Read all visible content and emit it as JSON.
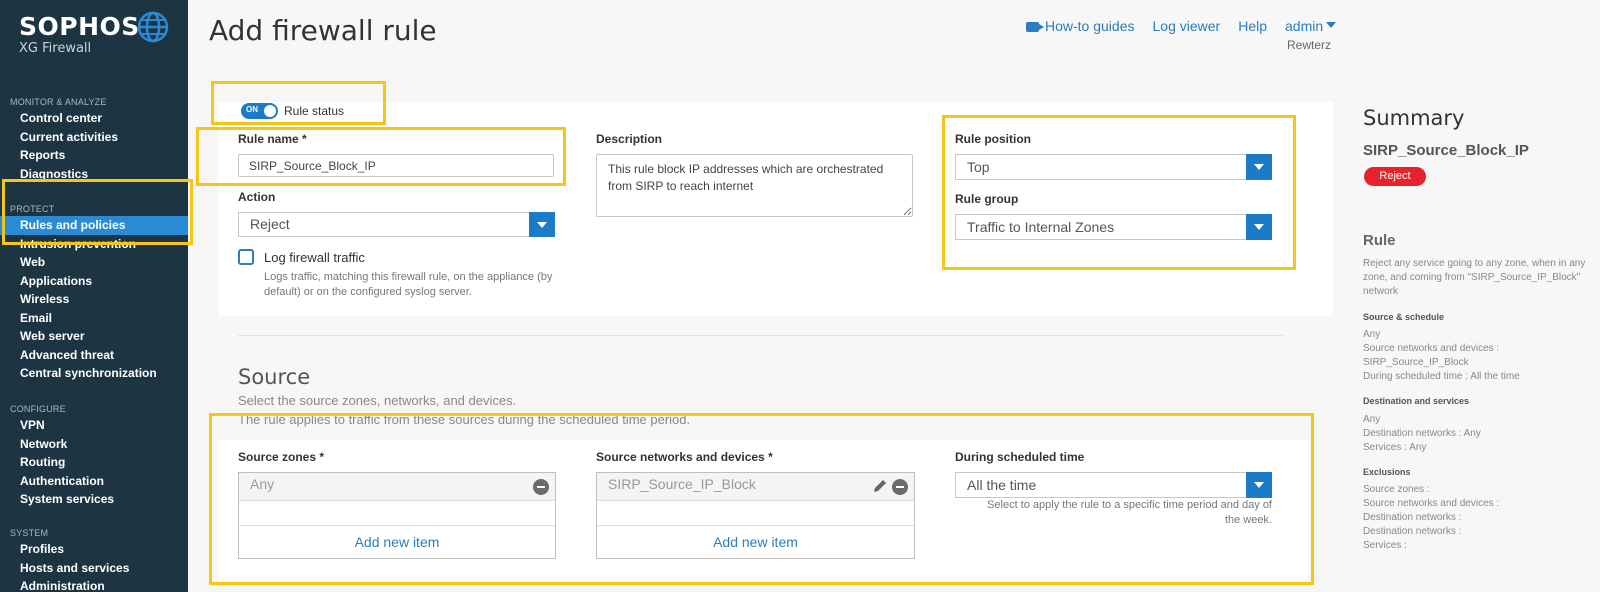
{
  "sidebar": {
    "brand": "SOPHOS",
    "product": "XG Firewall",
    "sections": [
      {
        "heading": "MONITOR & ANALYZE",
        "items": [
          "Control center",
          "Current activities",
          "Reports",
          "Diagnostics"
        ]
      },
      {
        "heading": "PROTECT",
        "items": [
          "Rules and policies",
          "Intrusion prevention",
          "Web",
          "Applications",
          "Wireless",
          "Email",
          "Web server",
          "Advanced threat",
          "Central synchronization"
        ]
      },
      {
        "heading": "CONFIGURE",
        "items": [
          "VPN",
          "Network",
          "Routing",
          "Authentication",
          "System services"
        ]
      },
      {
        "heading": "SYSTEM",
        "items": [
          "Profiles",
          "Hosts and services",
          "Administration"
        ]
      }
    ],
    "active_item": "Rules and policies"
  },
  "header": {
    "title": "Add firewall rule",
    "links": {
      "howto": "How-to guides",
      "log": "Log viewer",
      "help": "Help",
      "user": "admin"
    },
    "user_sub": "Rewterz"
  },
  "form": {
    "status_label": "Rule status",
    "status_toggle": "ON",
    "rule_name_label": "Rule name *",
    "rule_name_value": "SIRP_Source_Block_IP",
    "description_label": "Description",
    "description_value": "This rule block IP addresses which are orchestrated from SIRP to reach internet",
    "action_label": "Action",
    "action_value": "Reject",
    "log_label": "Log firewall traffic",
    "log_help": "Logs traffic, matching this firewall rule, on the appliance (by default) or on the configured syslog server.",
    "rule_position_label": "Rule position",
    "rule_position_value": "Top",
    "rule_group_label": "Rule group",
    "rule_group_value": "Traffic to Internal Zones"
  },
  "source": {
    "title": "Source",
    "desc1": "Select the source zones, networks, and devices.",
    "desc2": "The rule applies to traffic from these sources during the scheduled time period.",
    "zones_label": "Source zones *",
    "zones_value": "Any",
    "zones_add": "Add new item",
    "networks_label": "Source networks and devices *",
    "networks_value": "SIRP_Source_IP_Block",
    "networks_add": "Add new item",
    "schedule_label": "During scheduled time",
    "schedule_value": "All the time",
    "schedule_help": "Select to apply the rule to a specific time period and day of the week."
  },
  "summary": {
    "title": "Summary",
    "rule_name": "SIRP_Source_Block_IP",
    "action_badge": "Reject",
    "rule_heading": "Rule",
    "rule_text": "Reject any service going to any zone, when in any zone, and coming from \"SIRP_Source_IP_Block\" network",
    "src_heading": "Source & schedule",
    "src_lines": [
      "Any",
      "Source networks and devices :",
      "SIRP_Source_IP_Block",
      "During scheduled time : All the time"
    ],
    "dst_heading": "Destination and services",
    "dst_lines": [
      "Any",
      "Destination networks : Any",
      "Services : Any"
    ],
    "exc_heading": "Exclusions",
    "exc_lines": [
      "Source zones :",
      "Source networks and devices :",
      "Destination networks :",
      "Destination networks :",
      "Services :"
    ]
  },
  "colors": {
    "sidebar": "#1d3543",
    "accent": "#1a7bc9",
    "highlight": "#f5c518",
    "reject": "#e8222a"
  }
}
